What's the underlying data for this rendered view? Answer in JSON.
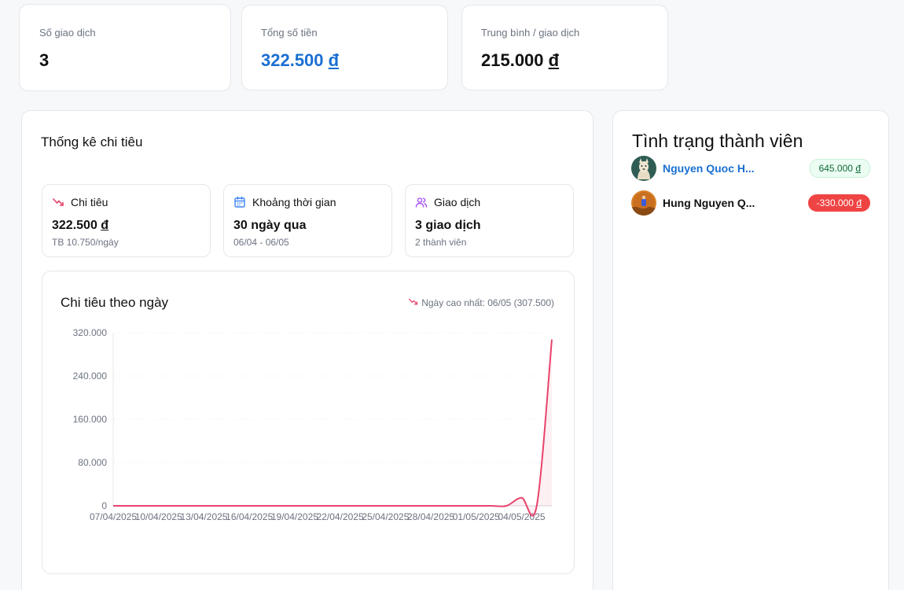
{
  "stats": [
    {
      "label": "Số giao dịch",
      "value": "3"
    },
    {
      "label": "Tổng số tiền",
      "value": "322.500",
      "currency": "đ"
    },
    {
      "label": "Trung bình / giao dịch",
      "value": "215.000",
      "currency": "đ"
    }
  ],
  "spending_panel": {
    "title": "Thống kê chi tiêu",
    "mini_cards": [
      {
        "icon": "trending-down-icon",
        "label": "Chi tiêu",
        "value": "322.500",
        "currency": "đ",
        "sub": "TB 10.750/ngày"
      },
      {
        "icon": "calendar-icon",
        "label": "Khoảng thời gian",
        "value": "30 ngày qua",
        "sub": "06/04 - 06/05"
      },
      {
        "icon": "users-icon",
        "label": "Giao dịch",
        "value": "3 giao dịch",
        "sub": "2 thành viên"
      }
    ]
  },
  "daily_chart": {
    "title": "Chi tiêu theo ngày",
    "note": "Ngày cao nhất: 06/05 (307.500)"
  },
  "chart_data": {
    "type": "area",
    "title": "Chi tiêu theo ngày",
    "xlabel": "",
    "ylabel": "",
    "ylim": [
      0,
      320000
    ],
    "ytick_labels": [
      "0",
      "80.000",
      "160.000",
      "240.000",
      "320.000"
    ],
    "ytick_values": [
      0,
      80000,
      160000,
      240000,
      320000
    ],
    "xtick_labels": [
      "07/04/2025",
      "10/04/2025",
      "13/04/2025",
      "16/04/2025",
      "19/04/2025",
      "22/04/2025",
      "25/04/2025",
      "28/04/2025",
      "01/05/2025",
      "04/05/2025"
    ],
    "x": [
      "07/04/2025",
      "08/04/2025",
      "09/04/2025",
      "10/04/2025",
      "11/04/2025",
      "12/04/2025",
      "13/04/2025",
      "14/04/2025",
      "15/04/2025",
      "16/04/2025",
      "17/04/2025",
      "18/04/2025",
      "19/04/2025",
      "20/04/2025",
      "21/04/2025",
      "22/04/2025",
      "23/04/2025",
      "24/04/2025",
      "25/04/2025",
      "26/04/2025",
      "27/04/2025",
      "28/04/2025",
      "29/04/2025",
      "30/04/2025",
      "01/05/2025",
      "02/05/2025",
      "03/05/2025",
      "04/05/2025",
      "05/05/2025",
      "06/05/2025"
    ],
    "values": [
      0,
      0,
      0,
      0,
      0,
      0,
      0,
      0,
      0,
      0,
      0,
      0,
      0,
      0,
      0,
      0,
      0,
      0,
      0,
      0,
      0,
      0,
      0,
      0,
      0,
      0,
      0,
      15000,
      0,
      307500
    ],
    "grid": true,
    "color": "#e8436b"
  },
  "members_panel": {
    "title": "Tình trạng thành viên",
    "members": [
      {
        "name": "Nguyen Quoc H...",
        "amount": "645.000",
        "currency": "đ",
        "status": "positive"
      },
      {
        "name": "Hung Nguyen Q...",
        "amount": "-330.000",
        "currency": "đ",
        "status": "negative"
      }
    ]
  },
  "colors": {
    "accent": "#1a6fd1",
    "chart_line": "#e8436b",
    "negative": "#ef4444",
    "positive_bg": "#ecfdf3"
  }
}
